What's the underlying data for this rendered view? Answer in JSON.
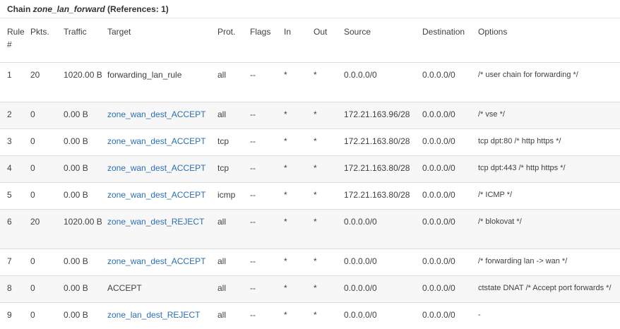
{
  "chain": {
    "prefix": "Chain ",
    "name": "zone_lan_forward",
    "refs": " (References: 1)"
  },
  "columns": {
    "rule": "Rule #",
    "pkts": "Pkts.",
    "traffic": "Traffic",
    "target": "Target",
    "prot": "Prot.",
    "flags": "Flags",
    "in": "In",
    "out": "Out",
    "source": "Source",
    "destination": "Destination",
    "options": "Options"
  },
  "rows": [
    {
      "rule": "1",
      "pkts": "20",
      "traffic": "1020.00 B",
      "target": "forwarding_lan_rule",
      "target_link": false,
      "prot": "all",
      "flags": "--",
      "in": "*",
      "out": "*",
      "source": "0.0.0.0/0",
      "destination": "0.0.0.0/0",
      "options": "/* user chain for forwarding */"
    },
    {
      "rule": "2",
      "pkts": "0",
      "traffic": "0.00 B",
      "target": "zone_wan_dest_ACCEPT",
      "target_link": true,
      "prot": "all",
      "flags": "--",
      "in": "*",
      "out": "*",
      "source": "172.21.163.96/28",
      "destination": "0.0.0.0/0",
      "options": "/* vse */"
    },
    {
      "rule": "3",
      "pkts": "0",
      "traffic": "0.00 B",
      "target": "zone_wan_dest_ACCEPT",
      "target_link": true,
      "prot": "tcp",
      "flags": "--",
      "in": "*",
      "out": "*",
      "source": "172.21.163.80/28",
      "destination": "0.0.0.0/0",
      "options": "tcp dpt:80 /* http https */"
    },
    {
      "rule": "4",
      "pkts": "0",
      "traffic": "0.00 B",
      "target": "zone_wan_dest_ACCEPT",
      "target_link": true,
      "prot": "tcp",
      "flags": "--",
      "in": "*",
      "out": "*",
      "source": "172.21.163.80/28",
      "destination": "0.0.0.0/0",
      "options": "tcp dpt:443 /* http https */"
    },
    {
      "rule": "5",
      "pkts": "0",
      "traffic": "0.00 B",
      "target": "zone_wan_dest_ACCEPT",
      "target_link": true,
      "prot": "icmp",
      "flags": "--",
      "in": "*",
      "out": "*",
      "source": "172.21.163.80/28",
      "destination": "0.0.0.0/0",
      "options": "/* ICMP */"
    },
    {
      "rule": "6",
      "pkts": "20",
      "traffic": "1020.00 B",
      "target": "zone_wan_dest_REJECT",
      "target_link": true,
      "prot": "all",
      "flags": "--",
      "in": "*",
      "out": "*",
      "source": "0.0.0.0/0",
      "destination": "0.0.0.0/0",
      "options": "/* blokovat */"
    },
    {
      "rule": "7",
      "pkts": "0",
      "traffic": "0.00 B",
      "target": "zone_wan_dest_ACCEPT",
      "target_link": true,
      "prot": "all",
      "flags": "--",
      "in": "*",
      "out": "*",
      "source": "0.0.0.0/0",
      "destination": "0.0.0.0/0",
      "options": "/* forwarding lan -> wan */"
    },
    {
      "rule": "8",
      "pkts": "0",
      "traffic": "0.00 B",
      "target": "ACCEPT",
      "target_link": false,
      "prot": "all",
      "flags": "--",
      "in": "*",
      "out": "*",
      "source": "0.0.0.0/0",
      "destination": "0.0.0.0/0",
      "options": "ctstate DNAT /* Accept port forwards */"
    },
    {
      "rule": "9",
      "pkts": "0",
      "traffic": "0.00 B",
      "target": "zone_lan_dest_REJECT",
      "target_link": true,
      "prot": "all",
      "flags": "--",
      "in": "*",
      "out": "*",
      "source": "0.0.0.0/0",
      "destination": "0.0.0.0/0",
      "options": "-"
    }
  ]
}
